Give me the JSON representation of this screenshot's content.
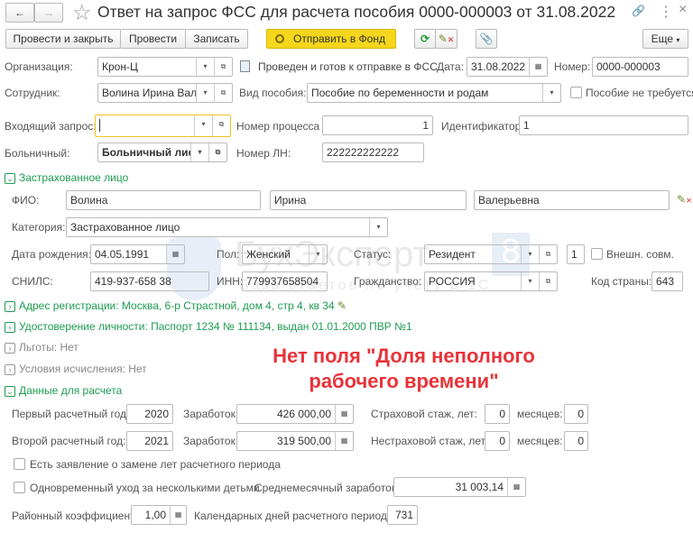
{
  "window": {
    "title": "Ответ на запрос ФСС для расчета пособия 0000-000003 от 31.08.2022",
    "back": "←",
    "forward": "→",
    "star": "☆",
    "link": "🔗",
    "menu": "⋮",
    "close": "×"
  },
  "toolbar": {
    "post_close": "Провести и закрыть",
    "post": "Провести",
    "save": "Записать",
    "send": "Отправить в Фонд",
    "more": "Еще"
  },
  "header": {
    "org_label": "Организация:",
    "org": "Крон-Ц",
    "status": "Проведен и готов к отправке в ФСС",
    "date_label": "Дата:",
    "date": "31.08.2022",
    "number_label": "Номер:",
    "number": "0000-000003",
    "employee_label": "Сотрудник:",
    "employee": "Волина Ирина Валерьевн",
    "benefit_label": "Вид пособия:",
    "benefit": "Пособие по беременности и родам",
    "not_required": "Пособие не требуется",
    "request_label": "Входящий запрос:",
    "request": "",
    "process_label": "Номер процесса",
    "process": "1",
    "id_label": "Идентификатор:",
    "id": "1",
    "sick_label": "Больничный:",
    "sick": "Больничный лист",
    "ln_label": "Номер ЛН:",
    "ln": "222222222222"
  },
  "insured": {
    "section": "Застрахованное лицо",
    "fio_label": "ФИО:",
    "last": "Волина",
    "first": "Ирина",
    "middle": "Валерьевна",
    "category_label": "Категория:",
    "category": "Застрахованное лицо",
    "birth_label": "Дата рождения:",
    "birth": "04.05.1991",
    "sex_label": "Пол:",
    "sex": "Женский",
    "status_label": "Статус:",
    "status": "Резидент",
    "status_code": "1",
    "ext_label": "Внешн. совм.",
    "snils_label": "СНИЛС:",
    "snils": "419-937-658 38",
    "inn_label": "ИНН:",
    "inn": "779937658504",
    "citizen_label": "Гражданство:",
    "citizen": "РОССИЯ",
    "country_label": "Код страны:",
    "country": "643"
  },
  "sections": {
    "address": "Адрес регистрации: Москва, 6-р Страстной, дом 4, стр 4, кв 34",
    "identity": "Удостоверение личности: Паспорт 1234 № 111134, выдан 01.01.2000 ПВР №1",
    "benefits": "Льготы: Нет",
    "conditions": "Условия исчисления: Нет",
    "calc": "Данные для расчета"
  },
  "annotation": {
    "line1": "Нет поля \"Доля неполного",
    "line2": "рабочего времени\""
  },
  "watermark": {
    "brand": "БухЭксперт 8",
    "tagline": "База ответов по учету в 1С"
  },
  "calc": {
    "year1_label": "Первый расчетный год:",
    "year1": "2020",
    "earn_label": "Заработок:",
    "earn1": "426 000,00",
    "ins_label": "Страховой стаж, лет:",
    "ins_years": "0",
    "months_label": "месяцев:",
    "ins_months": "0",
    "year2_label": "Второй расчетный год:",
    "year2": "2021",
    "earn2": "319 500,00",
    "nonins_label": "Нестраховой стаж, лет:",
    "nonins_years": "0",
    "nonins_months": "0",
    "replace_label": "Есть заявление о замене лет расчетного периода",
    "multi_label": "Одновременный уход за несколькими детьми",
    "avg_label": "Среднемесячный заработок:",
    "avg": "31 003,14",
    "coef_label": "Районный коэффициент:",
    "coef": "1,00",
    "days_label": "Календарных дней расчетного периода:",
    "days": "731"
  }
}
